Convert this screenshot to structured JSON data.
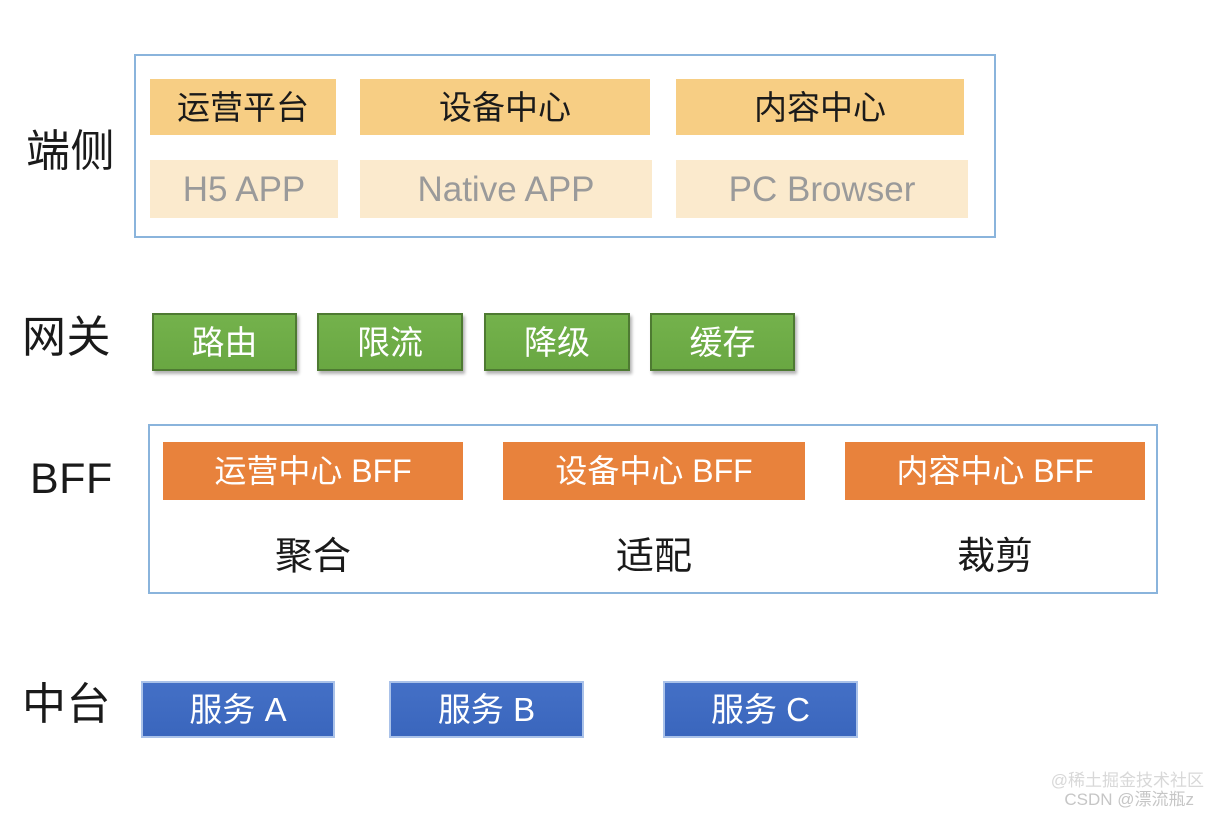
{
  "diagram": {
    "tiers": {
      "client": {
        "label": "端侧",
        "apps": [
          {
            "name": "运营平台"
          },
          {
            "name": "设备中心"
          },
          {
            "name": "内容中心"
          }
        ],
        "devices": [
          {
            "name": "H5 APP"
          },
          {
            "name": "Native APP"
          },
          {
            "name": "PC Browser"
          }
        ]
      },
      "gateway": {
        "label": "网关",
        "capabilities": [
          {
            "name": "路由"
          },
          {
            "name": "限流"
          },
          {
            "name": "降级"
          },
          {
            "name": "缓存"
          }
        ]
      },
      "bff": {
        "label": "BFF",
        "services": [
          {
            "name": "运营中心 BFF",
            "caption": "聚合"
          },
          {
            "name": "设备中心 BFF",
            "caption": "适配"
          },
          {
            "name": "内容中心 BFF",
            "caption": "裁剪"
          }
        ]
      },
      "midend": {
        "label": "中台",
        "services": [
          {
            "name": "服务 A"
          },
          {
            "name": "服务 B"
          },
          {
            "name": "服务 C"
          }
        ]
      }
    },
    "watermarks": {
      "juejin": "@稀土掘金技术社区",
      "csdn": "CSDN @漂流瓶z"
    },
    "colors": {
      "app_chip": "#F7CE84",
      "device_chip": "#FBEACD",
      "gateway_chip": "#6FAE46",
      "bff_chip": "#E8823C",
      "service_chip": "#3C6CC4",
      "container_border": "#8AB4DC"
    }
  }
}
